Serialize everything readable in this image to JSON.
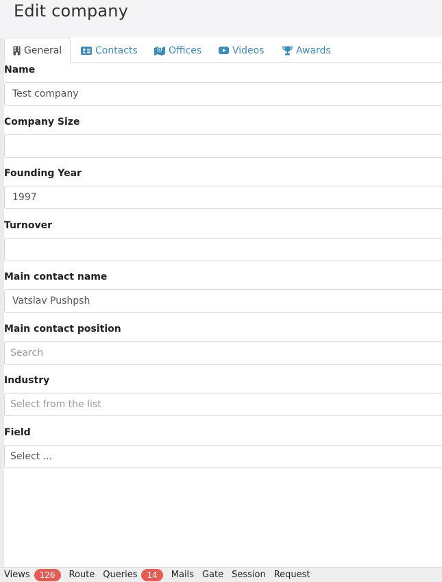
{
  "page": {
    "title": "Edit company"
  },
  "tabs": [
    {
      "label": "General",
      "icon": "building-icon",
      "active": true
    },
    {
      "label": "Contacts",
      "icon": "address-card-icon",
      "active": false
    },
    {
      "label": "Offices",
      "icon": "map-icon",
      "active": false
    },
    {
      "label": "Videos",
      "icon": "youtube-play-icon",
      "active": false
    },
    {
      "label": "Awards",
      "icon": "trophy-icon",
      "active": false
    }
  ],
  "form": {
    "name": {
      "label": "Name",
      "value": "Test company"
    },
    "company_size": {
      "label": "Company Size",
      "value": ""
    },
    "founding_year": {
      "label": "Founding Year",
      "value": "1997"
    },
    "turnover": {
      "label": "Turnover",
      "value": ""
    },
    "main_contact_name": {
      "label": "Main contact name",
      "value": "Vatslav Pushpsh"
    },
    "main_contact_position": {
      "label": "Main contact position",
      "placeholder": "Search"
    },
    "industry": {
      "label": "Industry",
      "placeholder": "Select from the list"
    },
    "field": {
      "label": "Field",
      "placeholder": "Select ..."
    }
  },
  "debugbar": {
    "views_label": "Views",
    "views_count": "126",
    "route_label": "Route",
    "queries_label": "Queries",
    "queries_count": "14",
    "mails_label": "Mails",
    "gate_label": "Gate",
    "session_label": "Session",
    "request_label": "Request"
  },
  "colors": {
    "link": "#3c8dbc",
    "badge": "#e65c52",
    "border": "#d2d6de"
  }
}
